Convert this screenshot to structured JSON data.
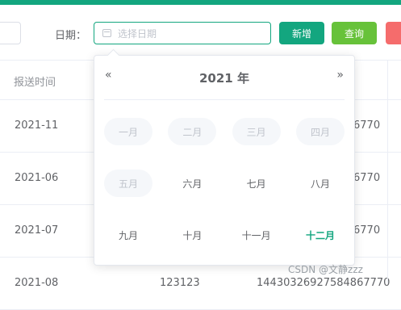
{
  "filter": {
    "date_label": "日期：",
    "date_placeholder": "选择日期",
    "add_button": "新增",
    "query_button": "查询"
  },
  "table": {
    "header": "报送时间",
    "rows": [
      {
        "date": "2021-11",
        "tail": "6770"
      },
      {
        "date": "2021-06",
        "tail": "6770"
      },
      {
        "date": "2021-07",
        "tail": "6770"
      },
      {
        "date": "2021-08",
        "mid": "123123",
        "mid2": "14430326927584867770"
      }
    ]
  },
  "picker": {
    "prev_year": "«",
    "next_year": "»",
    "year": "2021 年",
    "months": [
      [
        {
          "label": "一月",
          "state": "disabled"
        },
        {
          "label": "二月",
          "state": "disabled"
        },
        {
          "label": "三月",
          "state": "disabled"
        },
        {
          "label": "四月",
          "state": "disabled"
        }
      ],
      [
        {
          "label": "五月",
          "state": "disabled"
        },
        {
          "label": "六月",
          "state": "normal"
        },
        {
          "label": "七月",
          "state": "normal"
        },
        {
          "label": "八月",
          "state": "normal"
        }
      ],
      [
        {
          "label": "九月",
          "state": "normal"
        },
        {
          "label": "十月",
          "state": "normal"
        },
        {
          "label": "十一月",
          "state": "normal"
        },
        {
          "label": "十二月",
          "state": "current"
        }
      ]
    ]
  },
  "watermark": "CSDN @文静zzz",
  "colors": {
    "primary": "#13a67f",
    "query": "#67c23a",
    "danger": "#f56c6c"
  }
}
